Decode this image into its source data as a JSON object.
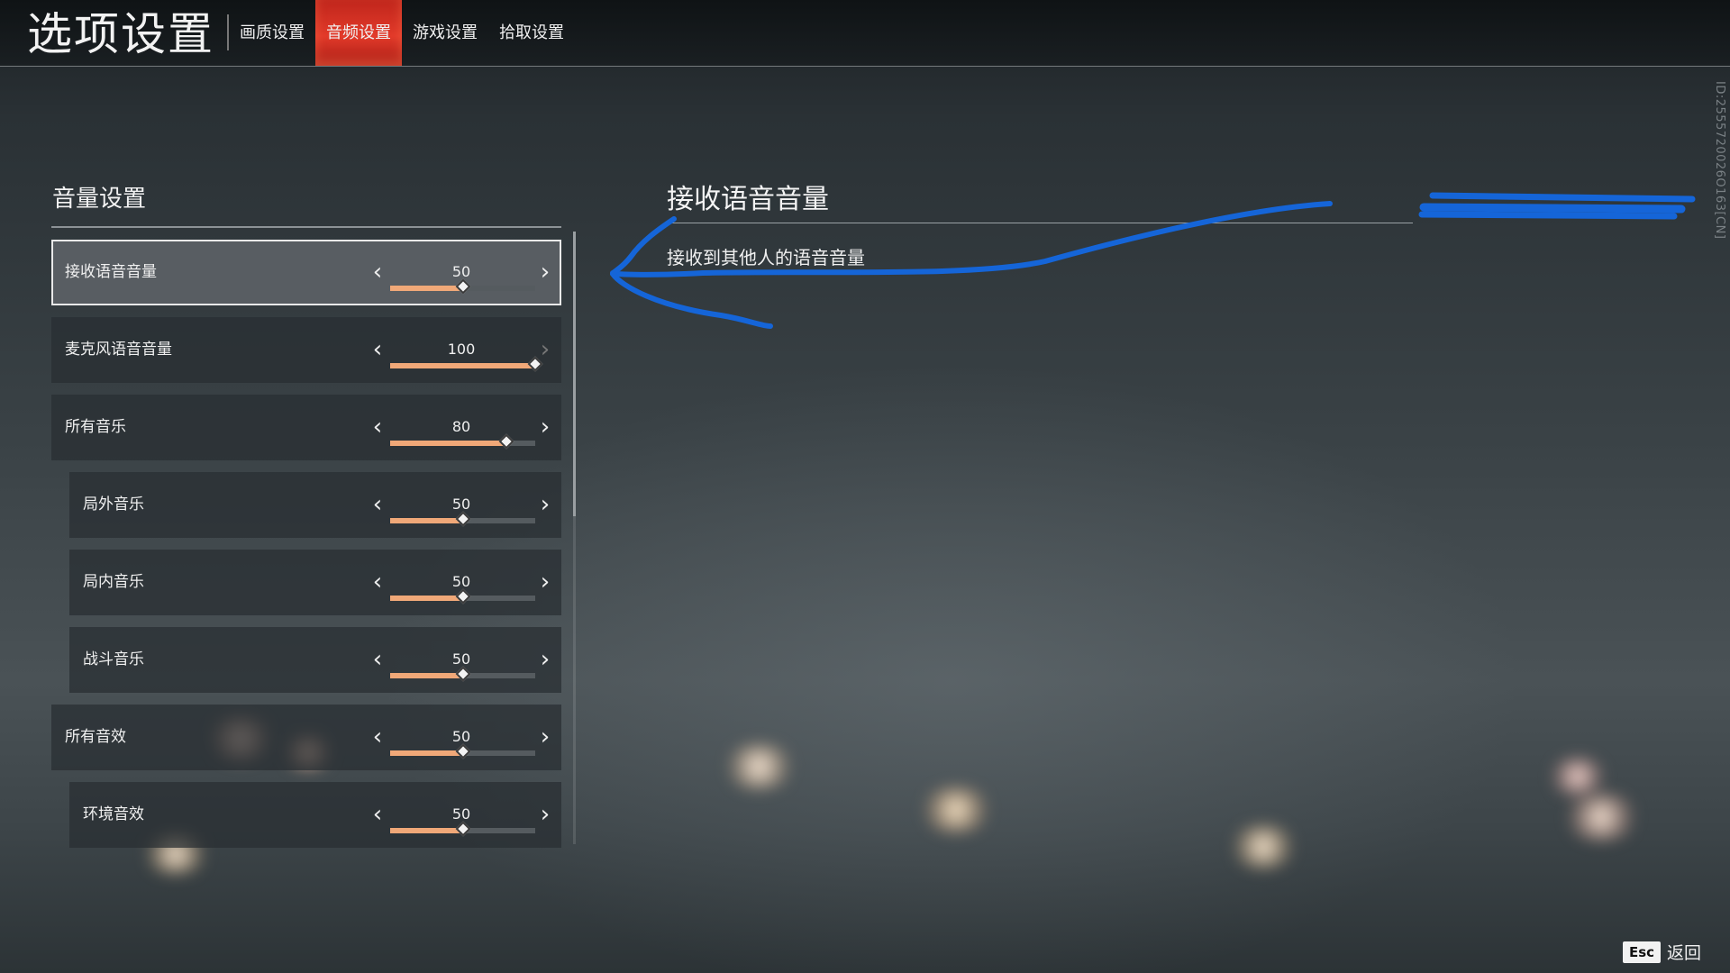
{
  "app": {
    "title": "选项设置",
    "version_id": "ID:2555720026O163[CN]"
  },
  "tabs": [
    {
      "label": "画质设置",
      "active": false
    },
    {
      "label": "音频设置",
      "active": true
    },
    {
      "label": "游戏设置",
      "active": false
    },
    {
      "label": "拾取设置",
      "active": false
    }
  ],
  "volume_section": {
    "title": "音量设置",
    "rows": [
      {
        "label": "接收语音音量",
        "value": "50",
        "level": 0.5,
        "selected": true,
        "indent": false,
        "right_enabled": true
      },
      {
        "label": "麦克风语音音量",
        "value": "100",
        "level": 1.0,
        "selected": false,
        "indent": false,
        "right_enabled": false
      },
      {
        "label": "所有音乐",
        "value": "80",
        "level": 0.8,
        "selected": false,
        "indent": false,
        "right_enabled": true
      },
      {
        "label": "局外音乐",
        "value": "50",
        "level": 0.5,
        "selected": false,
        "indent": true,
        "right_enabled": true
      },
      {
        "label": "局内音乐",
        "value": "50",
        "level": 0.5,
        "selected": false,
        "indent": true,
        "right_enabled": true
      },
      {
        "label": "战斗音乐",
        "value": "50",
        "level": 0.5,
        "selected": false,
        "indent": true,
        "right_enabled": true
      },
      {
        "label": "所有音效",
        "value": "50",
        "level": 0.5,
        "selected": false,
        "indent": false,
        "right_enabled": true
      },
      {
        "label": "环境音效",
        "value": "50",
        "level": 0.5,
        "selected": false,
        "indent": true,
        "right_enabled": true
      }
    ]
  },
  "detail": {
    "title": "接收语音音量",
    "description": "接收到其他人的语音音量"
  },
  "footer": {
    "esc_key": "Esc",
    "back_label": "返回"
  },
  "icons": {
    "left": "chevron-left-icon",
    "right": "chevron-right-icon",
    "left_glyph": "‹",
    "right_glyph": "›"
  },
  "colors": {
    "accent_tab": "#e23a2a",
    "slider_fill": "#f0a878",
    "annotation": "#1565d8"
  }
}
